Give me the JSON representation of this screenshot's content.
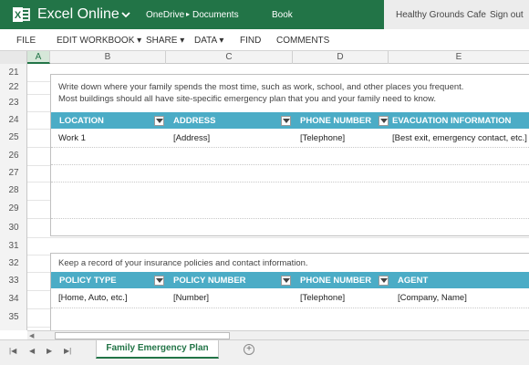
{
  "header": {
    "app_title": "Excel Online",
    "breadcrumb": [
      "OneDrive",
      "Documents"
    ],
    "breadcrumb_separator": "▸",
    "book": "Book",
    "company": "Healthy Grounds Cafe",
    "sign_out": "Sign out",
    "brand_color": "#227447"
  },
  "menu": [
    "FILE",
    "EDIT WORKBOOK ▾",
    "SHARE ▾",
    "DATA ▾",
    "FIND",
    "COMMENTS"
  ],
  "columns": [
    "A",
    "B",
    "C",
    "D",
    "E"
  ],
  "rows": [
    "21",
    "22",
    "23",
    "24",
    "25",
    "26",
    "27",
    "28",
    "29",
    "30",
    "31",
    "32",
    "33",
    "34",
    "35"
  ],
  "section1": {
    "line1": "Write down where your family spends the most time, such as work, school, and other places you frequent.",
    "line2": "Most buildings should all have site-specific emergency plan that you and your family need to know.",
    "headers": [
      "LOCATION",
      "ADDRESS",
      "PHONE NUMBER",
      "EVACUATION INFORMATION"
    ],
    "row": [
      "Work 1",
      "[Address]",
      "[Telephone]",
      "[Best exit, emergency contact, etc.]"
    ]
  },
  "section2": {
    "line1": "Keep a record of your insurance policies and contact information.",
    "headers": [
      "POLICY TYPE",
      "POLICY NUMBER",
      "PHONE NUMBER",
      "AGENT"
    ],
    "row": [
      "[Home, Auto, etc.]",
      "[Number]",
      "[Telephone]",
      "[Company, Name]"
    ]
  },
  "table_header_color": "#4bacc6",
  "sheet_tab": "Family Emergency Plan",
  "add_sheet": "+",
  "nav_buttons": [
    "first-sheet-icon",
    "prev-sheet-icon",
    "next-sheet-icon",
    "last-sheet-icon"
  ]
}
